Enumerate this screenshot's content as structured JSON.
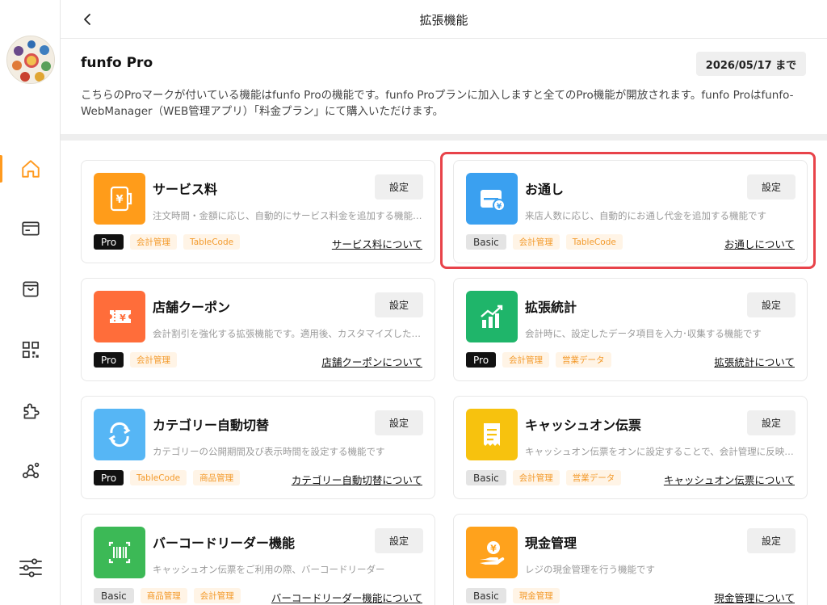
{
  "header": {
    "title": "拡張機能"
  },
  "intro": {
    "title": "funfo Pro",
    "expiry": "2026/05/17 まで",
    "description": "こちらのProマークが付いている機能はfunfo Proの機能です。funfo Proプランに加入しますと全てのPro機能が開放されます。funfo Proはfunfo-WebManager（WEB管理アプリ）「料金プラン」にて購入いただけます。"
  },
  "sidebar": {
    "items": [
      {
        "icon": "home-icon",
        "active": true
      },
      {
        "icon": "card-icon",
        "active": false
      },
      {
        "icon": "bag-icon",
        "active": false
      },
      {
        "icon": "qr-code-icon",
        "active": false
      },
      {
        "icon": "puzzle-icon",
        "active": false
      },
      {
        "icon": "network-icon",
        "active": false
      },
      {
        "icon": "sliders-icon",
        "active": false
      }
    ]
  },
  "colors": {
    "accent": "#ff9a1f",
    "highlight": "#e8434a",
    "tag_text": "#f39a2b"
  },
  "cards": [
    {
      "name": "サービス料",
      "desc": "注文時間・金額に応じ、自動的にサービス料金を追加する機能です",
      "plan": "Pro",
      "tags": [
        "会計管理",
        "TableCode"
      ],
      "link": "サービス料について",
      "set": "設定",
      "icon": "service-fee-icon",
      "color": "#ff9c1a"
    },
    {
      "name": "お通し",
      "desc": "来店人数に応じ、自動的にお通し代金を追加する機能です",
      "plan": "Basic",
      "tags": [
        "会計管理",
        "TableCode"
      ],
      "link": "お通しについて",
      "set": "設定",
      "icon": "otoshi-icon",
      "color": "#3aa0f0"
    },
    {
      "name": "店舗クーポン",
      "desc": "会計割引を強化する拡張機能です。適用後、カスタマイズしたクーポンで割引できます",
      "plan": "Pro",
      "tags": [
        "会計管理"
      ],
      "link": "店舗クーポンについて",
      "set": "設定",
      "icon": "coupon-icon",
      "color": "#ff6d3a"
    },
    {
      "name": "拡張統計",
      "desc": "会計時に、設定したデータ項目を入力･収集する機能です",
      "plan": "Pro",
      "tags": [
        "会計管理",
        "営業データ"
      ],
      "link": "拡張統計について",
      "set": "設定",
      "icon": "statistics-icon",
      "color": "#1fb56a"
    },
    {
      "name": "カテゴリー自動切替",
      "desc": "カテゴリーの公開期間及び表示時間を設定する機能です",
      "plan": "Pro",
      "tags": [
        "TableCode",
        "商品管理"
      ],
      "link": "カテゴリー自動切替について",
      "set": "設定",
      "icon": "auto-switch-icon",
      "color": "#56b6f5"
    },
    {
      "name": "キャッシュオン伝票",
      "desc": "キャッシュオン伝票をオンに設定することで、会計管理に反映される機能です",
      "plan": "Basic",
      "tags": [
        "会計管理",
        "営業データ"
      ],
      "link": "キャッシュオン伝票について",
      "set": "設定",
      "icon": "receipt-icon",
      "color": "#f7c20e"
    },
    {
      "name": "バーコードリーダー機能",
      "desc": "キャッシュオン伝票をご利用の際、バーコードリーダー",
      "plan": "Basic",
      "tags": [
        "商品管理",
        "会計管理"
      ],
      "link": "バーコードリーダー機能について",
      "set": "設定",
      "icon": "barcode-icon",
      "color": "#3cb956"
    },
    {
      "name": "現金管理",
      "desc": "レジの現金管理を行う機能です",
      "plan": "Basic",
      "tags": [
        "現金管理"
      ],
      "link": "現金管理について",
      "set": "設定",
      "icon": "cash-icon",
      "color": "#ffa21c"
    }
  ]
}
